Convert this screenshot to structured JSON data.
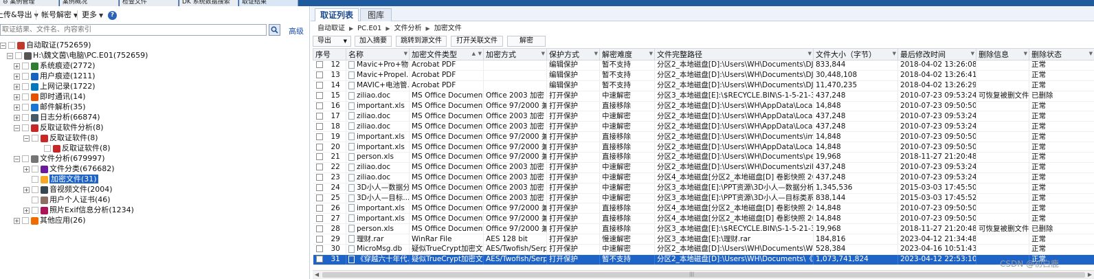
{
  "top_tabs": [
    {
      "label": "⊖ 案例管理"
    },
    {
      "label": "案例概况"
    },
    {
      "label": "检查文件"
    },
    {
      "label": "DK 系统数据搜索"
    },
    {
      "label": "取证结果"
    }
  ],
  "left_toolbar": {
    "upload_export": "上传&导出",
    "account_decrypt": "帐号解密",
    "more": "更多",
    "help": "?"
  },
  "search": {
    "placeholder": "取证结果、文件名、内容索引",
    "advanced": "高级"
  },
  "tree": [
    {
      "label": "自动取证(752659)",
      "level": 0,
      "expander": "⊟",
      "color": "#c0392b"
    },
    {
      "label": "H:\\魏文茵\\电脑\\PC.E01(752659)",
      "level": 1,
      "expander": "⊟",
      "color": "#555555"
    },
    {
      "label": "系统痕迹(2772)",
      "level": 2,
      "expander": "⊞",
      "color": "#2e7d32"
    },
    {
      "label": "用户痕迹(1211)",
      "level": 2,
      "expander": "⊞",
      "color": "#1565c0"
    },
    {
      "label": "上网记录(1722)",
      "level": 2,
      "expander": "⊞",
      "color": "#0277bd"
    },
    {
      "label": "即时通讯(14)",
      "level": 2,
      "expander": "⊞",
      "color": "#e65100"
    },
    {
      "label": "邮件解析(35)",
      "level": 2,
      "expander": "⊞",
      "color": "#1976d2"
    },
    {
      "label": "日志分析(66874)",
      "level": 2,
      "expander": "⊞",
      "color": "#455a64"
    },
    {
      "label": "反取证软件分析(8)",
      "level": 2,
      "expander": "⊟",
      "color": "#c62828"
    },
    {
      "label": "反取证软件(8)",
      "level": 3,
      "expander": "⊟",
      "color": "#c62828"
    },
    {
      "label": "反取证软件(8)",
      "level": 4,
      "expander": "",
      "color": "#c62828"
    },
    {
      "label": "文件分析(679997)",
      "level": 2,
      "expander": "⊟",
      "color": "#757575"
    },
    {
      "label": "文件分类(676682)",
      "level": 3,
      "expander": "⊞",
      "color": "#6a1b9a"
    },
    {
      "label": "加密文件(31)",
      "level": 3,
      "expander": "",
      "color": "#f9a825",
      "selected": true
    },
    {
      "label": "音视频文件(2004)",
      "level": 3,
      "expander": "⊞",
      "color": "#37474f"
    },
    {
      "label": "用户个人证书(46)",
      "level": 3,
      "expander": "",
      "color": "#8d6e63"
    },
    {
      "label": "照片Exif信息分析(1234)",
      "level": 3,
      "expander": "⊞",
      "color": "#ad1457"
    },
    {
      "label": "其他应用(26)",
      "level": 2,
      "expander": "⊞",
      "color": "#ef6c00"
    }
  ],
  "right_tabs": [
    {
      "label": "取证列表",
      "active": true
    },
    {
      "label": "图库",
      "active": false
    }
  ],
  "breadcrumb": [
    "自动取证",
    "PC.E01",
    "文件分析",
    "加密文件"
  ],
  "actions": {
    "export": "导出",
    "add_summary": "加入摘要",
    "goto_source": "跳转到源文件",
    "open_related": "打开关联文件",
    "decrypt": "解密"
  },
  "columns": [
    "序号",
    "名称",
    "加密文件类型",
    "加密方式",
    "保护方式",
    "解密难度",
    "文件完整路径",
    "文件大小（字节）",
    "最后修改时间",
    "删除信息",
    "删除状态"
  ],
  "rows": [
    {
      "seq": "12",
      "name": "Mavic+Pro+物...",
      "type": "Acrobat PDF",
      "method": "",
      "protect": "编辑保护",
      "difficulty": "暂不支持",
      "path": "分区2_本地磁盘[D]:\\Users\\WH\\Documents\\DJIG...",
      "size": "833,844",
      "mtime": "2018-04-02 13:26:08",
      "delinfo": "",
      "delstate": "正常"
    },
    {
      "seq": "13",
      "name": "Mavic+Propel...",
      "type": "Acrobat PDF",
      "method": "",
      "protect": "编辑保护",
      "difficulty": "暂不支持",
      "path": "分区2_本地磁盘[D]:\\Users\\WH\\Documents\\DJIGO...",
      "size": "30,448,108",
      "mtime": "2018-04-02 13:26:41",
      "delinfo": "",
      "delstate": "正常"
    },
    {
      "seq": "14",
      "name": "MAVIC+电池管...",
      "type": "Acrobat PDF",
      "method": "",
      "protect": "编辑保护",
      "difficulty": "暂不支持",
      "path": "分区2_本地磁盘[D]:\\Users\\WH\\Documents\\DJIG...",
      "size": "11,470,235",
      "mtime": "2018-04-02 13:26:29",
      "delinfo": "",
      "delstate": "正常"
    },
    {
      "seq": "15",
      "name": "ziliao.doc",
      "type": "MS Office Document",
      "method": "Office 2003 加密",
      "protect": "打开保护",
      "difficulty": "中速解密",
      "path": "分区3_本地磁盘[E]:\\$RECYCLE.BIN\\S-1-5-21-3092...",
      "size": "437,248",
      "mtime": "2010-07-23 09:53:24",
      "delinfo": "可恢复被删文件",
      "delstate": "已删除"
    },
    {
      "seq": "16",
      "name": "important.xls",
      "type": "MS Office Document",
      "method": "Office 97/2000 兼...",
      "protect": "打开保护",
      "difficulty": "直接移除",
      "path": "分区2_本地磁盘[D]:\\Users\\WH\\AppData\\Local\\T...",
      "size": "14,848",
      "mtime": "2010-07-23 09:50:50",
      "delinfo": "",
      "delstate": "正常"
    },
    {
      "seq": "17",
      "name": "ziliao.doc",
      "type": "MS Office Document",
      "method": "Office 2003 加密",
      "protect": "打开保护",
      "difficulty": "中速解密",
      "path": "分区2_本地磁盘[D]:\\Users\\WH\\AppData\\Local\\Te...",
      "size": "437,248",
      "mtime": "2010-07-23 09:53:24",
      "delinfo": "",
      "delstate": "正常"
    },
    {
      "seq": "18",
      "name": "ziliao.doc",
      "type": "MS Office Document",
      "method": "Office 2003 加密",
      "protect": "打开保护",
      "difficulty": "中速解密",
      "path": "分区2_本地磁盘[D]:\\Users\\WH\\AppData\\Local\\Te...",
      "size": "437,248",
      "mtime": "2010-07-23 09:53:24",
      "delinfo": "",
      "delstate": "正常"
    },
    {
      "seq": "19",
      "name": "important.xls",
      "type": "MS Office Document",
      "method": "Office 97/2000 兼...",
      "protect": "打开保护",
      "difficulty": "直接移除",
      "path": "分区2_本地磁盘[D]:\\Users\\WH\\Documents\\import...",
      "size": "14,848",
      "mtime": "2010-07-23 09:50:50",
      "delinfo": "",
      "delstate": "正常"
    },
    {
      "seq": "20",
      "name": "important.xls",
      "type": "MS Office Document",
      "method": "Office 97/2000 兼...",
      "protect": "打开保护",
      "difficulty": "直接移除",
      "path": "分区2_本地磁盘[D]:\\Users\\WH\\AppData\\Local\\T...",
      "size": "14,848",
      "mtime": "2010-07-23 09:50:50",
      "delinfo": "",
      "delstate": "正常"
    },
    {
      "seq": "21",
      "name": "person.xls",
      "type": "MS Office Document",
      "method": "Office 97/2000 兼...",
      "protect": "打开保护",
      "difficulty": "直接移除",
      "path": "分区2_本地磁盘[D]:\\Users\\WH\\Documents\\perso...",
      "size": "19,968",
      "mtime": "2018-11-27 21:20:48",
      "delinfo": "",
      "delstate": "正常"
    },
    {
      "seq": "22",
      "name": "ziliao.doc",
      "type": "MS Office Document",
      "method": "Office 2003 加密",
      "protect": "打开保护",
      "difficulty": "中速解密",
      "path": "分区2_本地磁盘[D]:\\Users\\WH\\Documents\\ziliao....",
      "size": "437,248",
      "mtime": "2010-07-23 09:53:24",
      "delinfo": "",
      "delstate": "正常"
    },
    {
      "seq": "23",
      "name": "ziliao.doc",
      "type": "MS Office Document",
      "method": "Office 2003 加密",
      "protect": "打开保护",
      "difficulty": "中速解密",
      "path": "分区4_本地磁盘[分区2_本地磁盘[D] 卷影快照 2023-...",
      "size": "437,248",
      "mtime": "2010-07-23 09:53:24",
      "delinfo": "",
      "delstate": "正常"
    },
    {
      "seq": "24",
      "name": "3D小人—数据分...",
      "type": "MS Office Document",
      "method": "Office 2003 加密",
      "protect": "打开保护",
      "difficulty": "中速解密",
      "path": "分区3_本地磁盘[E]:\\PPT资源\\3D小人—数据分析系列....",
      "size": "1,345,536",
      "mtime": "2015-03-03 17:45:50",
      "delinfo": "",
      "delstate": "正常"
    },
    {
      "seq": "25",
      "name": "3D小人—目标...",
      "type": "MS Office Document",
      "method": "Office 2003 加密",
      "protect": "打开保护",
      "difficulty": "中速解密",
      "path": "分区3_本地磁盘[E]:\\PPT资源\\3D小人—目标类系列.ppt",
      "size": "838,144",
      "mtime": "2015-03-03 17:45:52",
      "delinfo": "",
      "delstate": "正常"
    },
    {
      "seq": "26",
      "name": "important.xls",
      "type": "MS Office Document",
      "method": "Office 97/2000 兼...",
      "protect": "打开保护",
      "difficulty": "直接移除",
      "path": "分区4_本地磁盘[分区2_本地磁盘[D] 卷影快照 2023-0...",
      "size": "14,848",
      "mtime": "2010-07-23 09:50:50",
      "delinfo": "",
      "delstate": "正常"
    },
    {
      "seq": "27",
      "name": "important.xls",
      "type": "MS Office Document",
      "method": "Office 97/2000 兼...",
      "protect": "打开保护",
      "difficulty": "直接移除",
      "path": "分区4_本地磁盘[分区2_本地磁盘[D] 卷影快照 2023-0...",
      "size": "14,848",
      "mtime": "2010-07-23 09:50:50",
      "delinfo": "",
      "delstate": "正常"
    },
    {
      "seq": "28",
      "name": "person.xls",
      "type": "MS Office Document",
      "method": "Office 97/2000 兼...",
      "protect": "打开保护",
      "difficulty": "直接移除",
      "path": "分区3_本地磁盘[E]:\\$RECYCLE.BIN\\S-1-5-21-3092...",
      "size": "19,968",
      "mtime": "2018-11-27 21:20:48",
      "delinfo": "可恢复被删文件",
      "delstate": "已删除"
    },
    {
      "seq": "29",
      "name": "理财.rar",
      "type": "WinRar File",
      "method": "AES 128 bit",
      "protect": "打开保护",
      "difficulty": "慢速解密",
      "path": "分区3_本地磁盘[E]:\\理财.rar",
      "size": "184,816",
      "mtime": "2023-04-12 21:34:48",
      "delinfo": "",
      "delstate": "正常"
    },
    {
      "seq": "30",
      "name": "MicroMsg.db",
      "type": "疑似TrueCrypt加密文件",
      "method": "AES/Twofish/Serp...",
      "protect": "打开保护",
      "difficulty": "中速解密",
      "path": "分区2_本地磁盘[D]:\\Users\\WH\\Documents\\WeCha...",
      "size": "528,384",
      "mtime": "2023-04-16 10:51:43",
      "delinfo": "",
      "delstate": "正常"
    },
    {
      "seq": "31",
      "name": "《穿越六十年代...",
      "type": "疑似TrueCrypt加密文件",
      "method": "AES/Twofish/Serp...",
      "protect": "打开保护",
      "difficulty": "暂不支持",
      "path": "分区2_本地磁盘[D]:\\Users\\WH\\Documents\\《穿越...",
      "size": "1,073,741,824",
      "mtime": "2023-04-12 22:53:10",
      "delinfo": "",
      "delstate": "正常",
      "selected": true
    }
  ],
  "watermark": "CSDN @初白鹿"
}
